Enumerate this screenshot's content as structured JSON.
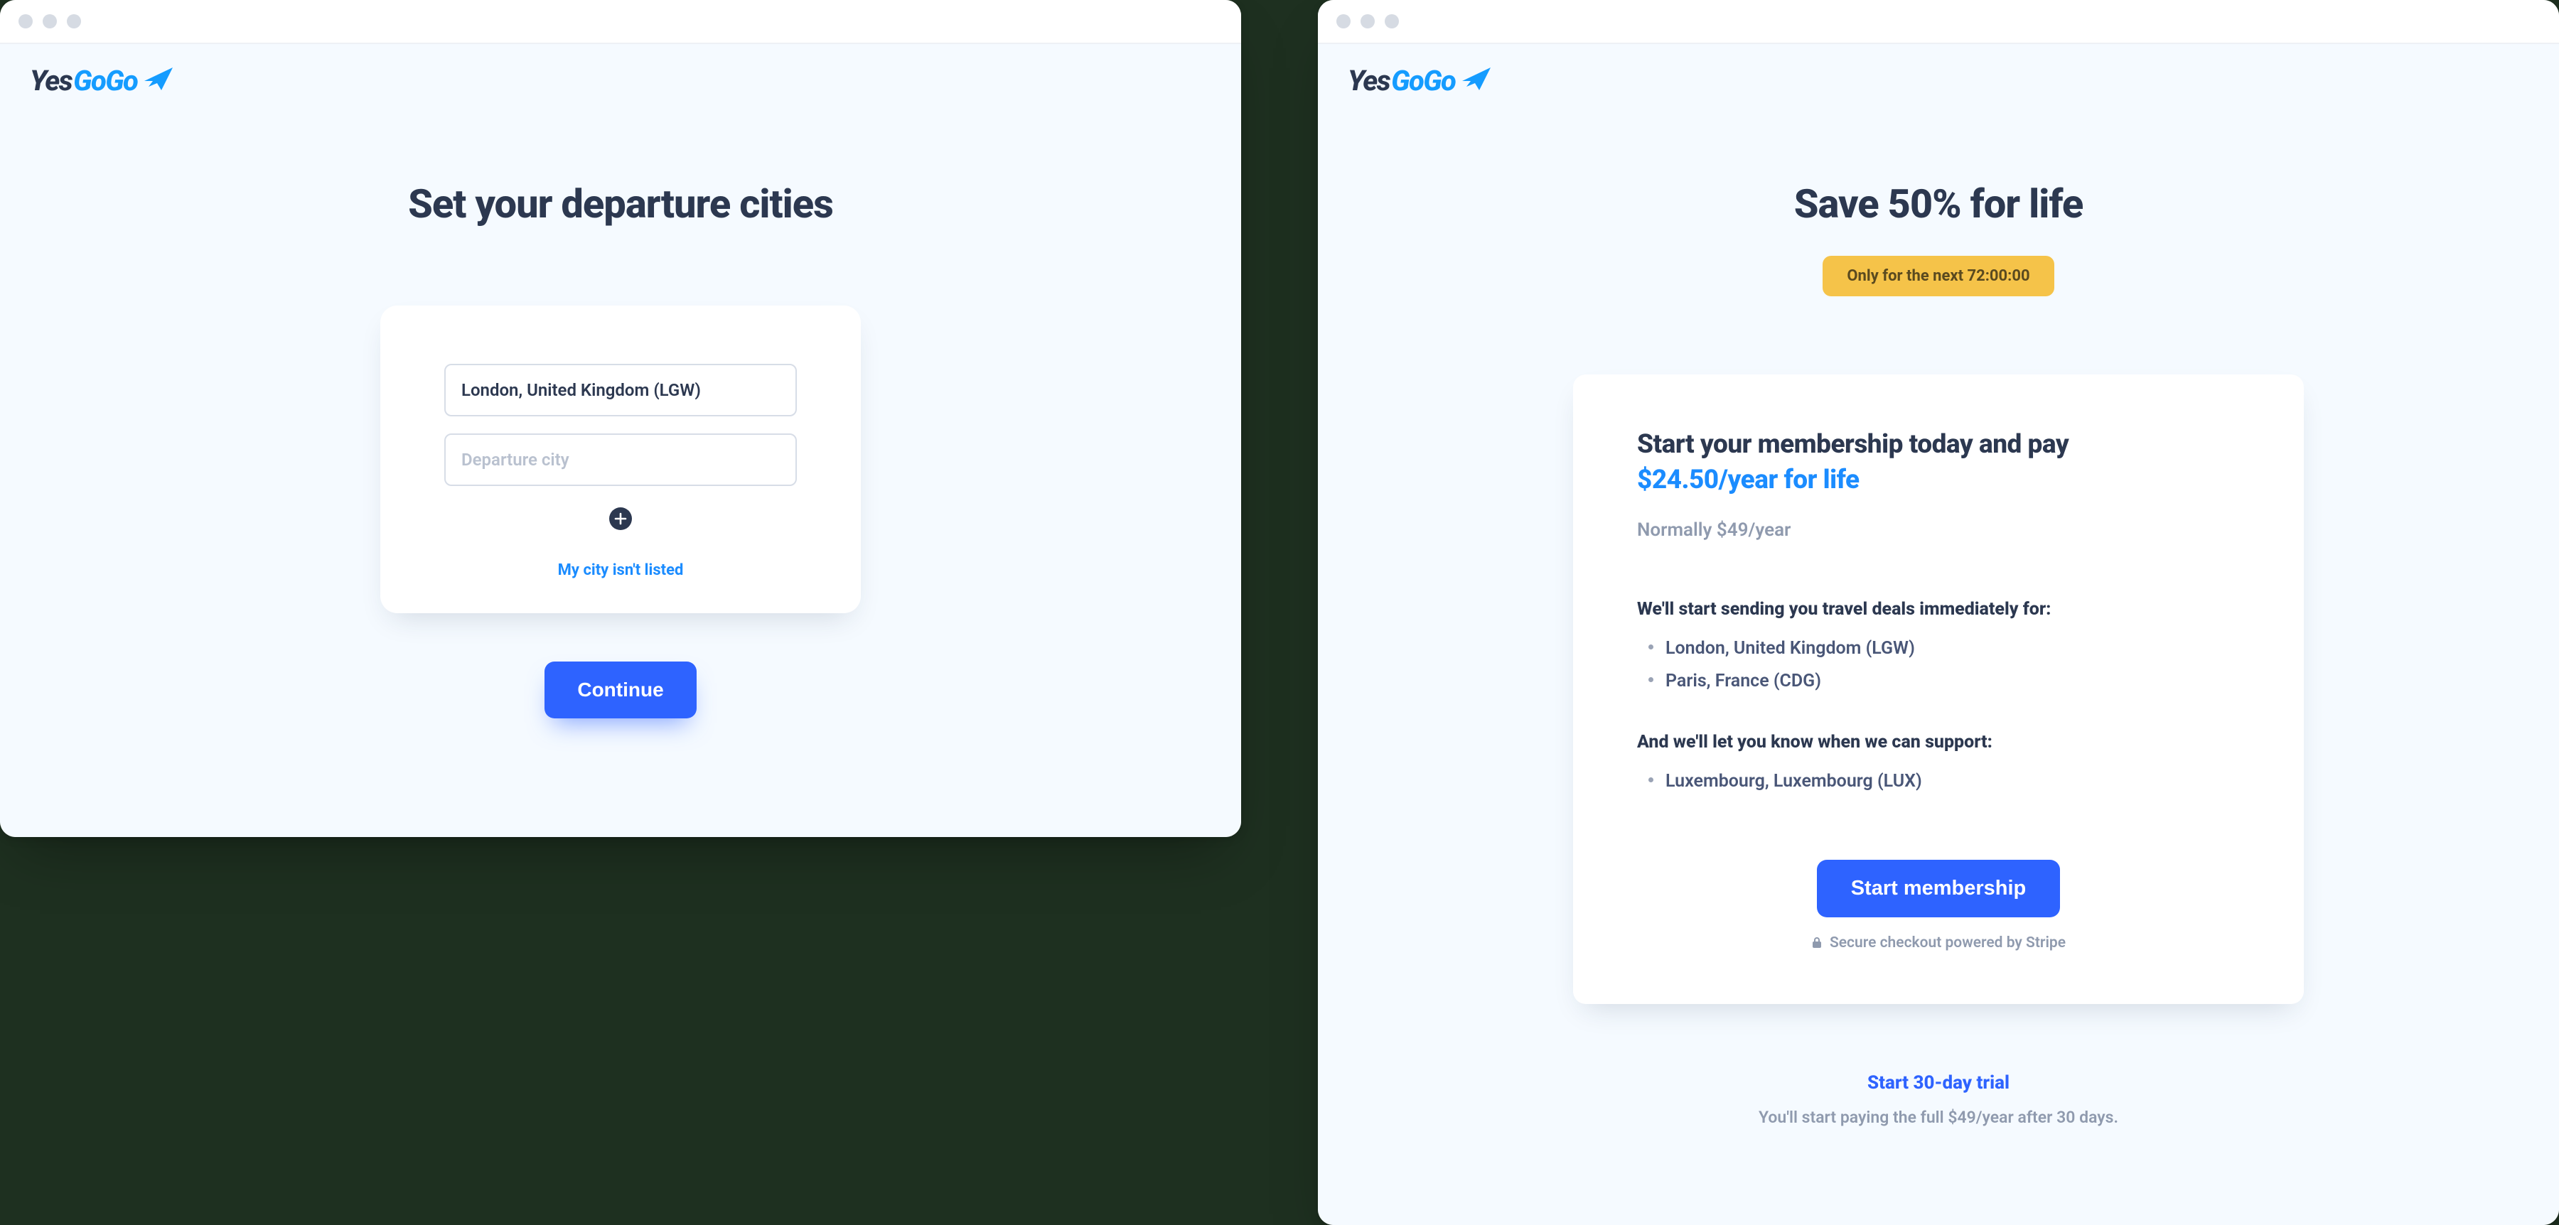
{
  "brand": {
    "name_part1": "Yes",
    "name_part2": "GoGo"
  },
  "left_panel": {
    "title": "Set your departure cities",
    "city_input_value": "London, United Kingdom (LGW)",
    "city_input_placeholder_secondary": "Departure city",
    "not_listed_link": "My city isn't listed",
    "continue_button": "Continue"
  },
  "right_panel": {
    "title": "Save 50% for life",
    "countdown_badge": "Only for the next 72:00:00",
    "offer_lead": "Start your membership today and pay",
    "offer_price": "$24.50/year for life",
    "normal_price": "Normally $49/year",
    "deals_heading": "We'll start sending you travel deals immediately for:",
    "deal_cities": [
      "London, United Kingdom (LGW)",
      "Paris, France (CDG)"
    ],
    "pending_heading": "And we'll let you know when we can support:",
    "pending_cities": [
      "Luxembourg, Luxembourg (LUX)"
    ],
    "start_membership_button": "Start membership",
    "secure_checkout_text": "Secure checkout powered by Stripe",
    "trial_link": "Start 30-day trial",
    "trial_subtext": "You'll start paying the full $49/year after 30 days."
  }
}
